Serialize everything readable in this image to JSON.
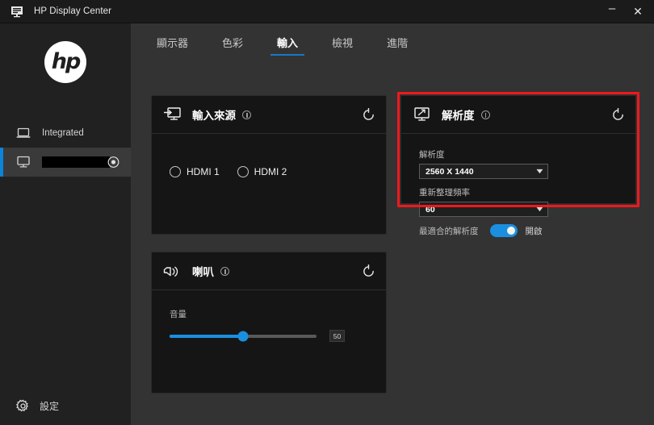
{
  "window": {
    "title": "HP Display Center",
    "app_icon": "monitor-icon",
    "minimize_label": "–",
    "close_label": "✕"
  },
  "sidebar": {
    "logo_text": "hp",
    "items": [
      {
        "label": "Integrated",
        "icon": "laptop-icon",
        "selected": false
      },
      {
        "label": "",
        "icon": "monitor-icon",
        "selected": true,
        "redacted": true,
        "right_icon": "target-icon"
      }
    ],
    "settings": {
      "label": "設定",
      "icon": "gear-icon"
    }
  },
  "tabs": [
    {
      "label": "顯示器",
      "active": false
    },
    {
      "label": "色彩",
      "active": false
    },
    {
      "label": "輸入",
      "active": true
    },
    {
      "label": "檢視",
      "active": false
    },
    {
      "label": "進階",
      "active": false
    }
  ],
  "cards": {
    "input_source": {
      "title": "輸入來源",
      "icon": "monitor-input-icon",
      "info_icon": "info-icon",
      "reset_icon": "reset-icon",
      "options": [
        {
          "label": "HDMI 1",
          "selected": false
        },
        {
          "label": "HDMI 2",
          "selected": false
        }
      ]
    },
    "resolution": {
      "title": "解析度",
      "icon": "monitor-resize-icon",
      "info_icon": "info-icon",
      "reset_icon": "reset-icon",
      "resolution_label": "解析度",
      "resolution_value": "2560 X 1440",
      "refresh_label": "重新整理頻率",
      "refresh_value": "60",
      "best_resolution_label": "最適合的解析度",
      "best_resolution_state": "開啟",
      "best_resolution_on": true
    },
    "speaker": {
      "title": "喇叭",
      "icon": "speaker-icon",
      "info_icon": "info-icon",
      "reset_icon": "reset-icon",
      "volume_label": "音量",
      "volume_value": "50",
      "volume_percent": 50
    }
  },
  "colors": {
    "accent": "#1a8fe0",
    "tab_underline": "#1878c8",
    "highlight": "#f0181c",
    "card_bg": "#151515",
    "panel_bg": "#333333",
    "sidebar_bg": "#212121"
  }
}
